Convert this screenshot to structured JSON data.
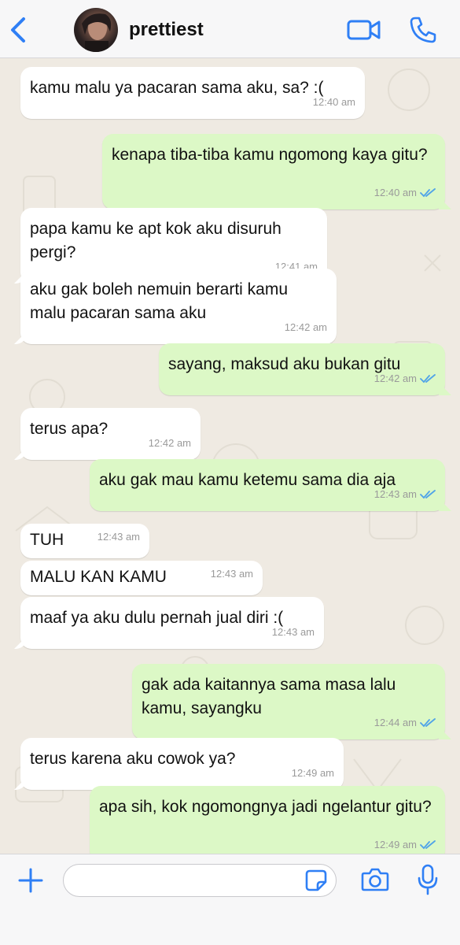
{
  "header": {
    "contact_name": "prettiest",
    "icons": {
      "back": "chevron-left-icon",
      "video": "video-camera-icon",
      "call": "phone-icon"
    },
    "accent": "#2f7ff5"
  },
  "messages": [
    {
      "dir": "in",
      "text": "kamu malu ya pacaran sama aku, sa? :(",
      "time": "12:40 am"
    },
    {
      "dir": "out",
      "text": "kenapa tiba-tiba kamu ngomong kaya gitu?",
      "time": "12:40 am",
      "read": true
    },
    {
      "dir": "in",
      "text": "papa kamu ke apt kok aku disuruh pergi?",
      "time": "12:41 am"
    },
    {
      "dir": "in",
      "text": "aku gak boleh nemuin berarti kamu malu pacaran sama aku",
      "time": "12:42 am"
    },
    {
      "dir": "out",
      "text": "sayang, maksud aku bukan gitu",
      "time": "12:42 am",
      "read": true
    },
    {
      "dir": "in",
      "text": "terus apa?",
      "time": "12:42 am"
    },
    {
      "dir": "out",
      "text": "aku gak mau kamu ketemu sama dia aja",
      "time": "12:43 am",
      "read": true
    },
    {
      "dir": "in",
      "text": "TUH",
      "time": "12:43 am"
    },
    {
      "dir": "in",
      "text": "MALU KAN KAMU",
      "time": "12:43 am"
    },
    {
      "dir": "in",
      "text": "maaf ya aku dulu pernah jual diri :(",
      "time": "12:43 am"
    },
    {
      "dir": "out",
      "text": "gak ada kaitannya sama masa lalu kamu, sayangku",
      "time": "12:44 am",
      "read": true
    },
    {
      "dir": "in",
      "text": "terus karena aku cowok ya?",
      "time": "12:49 am"
    },
    {
      "dir": "out",
      "text": "apa sih, kok ngomongnya jadi ngelantur gitu?",
      "time": "12:49 am",
      "read": true
    }
  ],
  "colors": {
    "incoming": "#ffffff",
    "outgoing": "#dcf8c6",
    "read_ticks": "#4fa3e8",
    "background": "#efeae2"
  },
  "input_bar": {
    "message_value": "",
    "icons": {
      "attach": "plus-icon",
      "sticker": "sticker-icon",
      "camera": "camera-icon",
      "mic": "microphone-icon"
    }
  }
}
